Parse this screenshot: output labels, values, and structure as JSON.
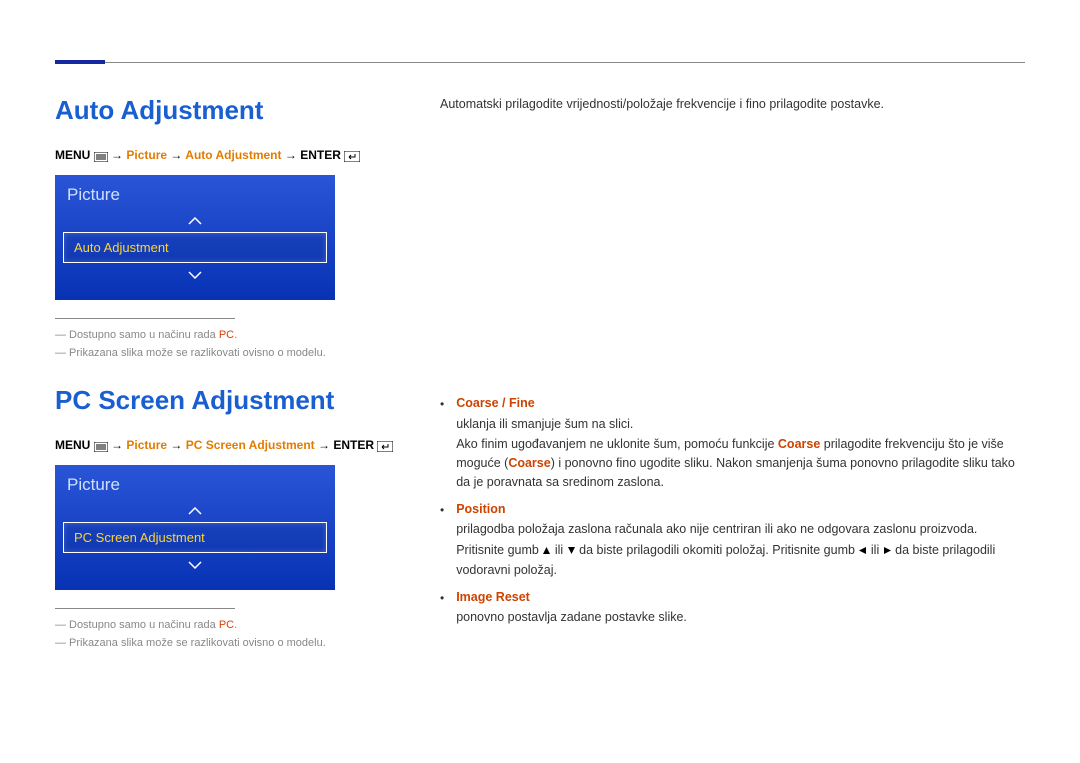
{
  "section1": {
    "title": "Auto Adjustment",
    "breadcrumb": {
      "menu": "MENU",
      "arrow": "→",
      "p1": "Picture",
      "p2": "Auto Adjustment",
      "enter": "ENTER"
    },
    "panel": {
      "title": "Picture",
      "item": "Auto Adjustment"
    },
    "notes": {
      "n1a": "Dostupno samo u načinu rada ",
      "n1b": "PC",
      "n1c": ".",
      "n2": "Prikazana slika može se razlikovati ovisno o modelu."
    }
  },
  "section2": {
    "title": "PC Screen Adjustment",
    "breadcrumb": {
      "menu": "MENU",
      "arrow": "→",
      "p1": "Picture",
      "p2": "PC Screen Adjustment",
      "enter": "ENTER"
    },
    "panel": {
      "title": "Picture",
      "item": "PC Screen Adjustment"
    },
    "notes": {
      "n1a": "Dostupno samo u načinu rada ",
      "n1b": "PC",
      "n1c": ".",
      "n2": "Prikazana slika može se razlikovati ovisno o modelu."
    }
  },
  "right": {
    "intro": "Automatski prilagodite vrijednosti/položaje frekvencije i fino prilagodite postavke.",
    "b1": {
      "label": "Coarse / Fine",
      "t1": "uklanja ili smanjuje šum na slici.",
      "t2a": "Ako finim ugođavanjem ne uklonite šum, pomoću funkcije ",
      "t2b": "Coarse",
      "t2c": " prilagodite frekvenciju što je više moguće (",
      "t2d": "Coarse",
      "t2e": ") i ponovno fino ugodite sliku. Nakon smanjenja šuma ponovno prilagodite sliku tako da je poravnata sa sredinom zaslona."
    },
    "b2": {
      "label": "Position",
      "t1": "prilagodba položaja zaslona računala ako nije centriran ili ako ne odgovara zaslonu proizvoda.",
      "t2a": "Pritisnite gumb ",
      "t2b": " ili ",
      "t2c": " da biste prilagodili okomiti položaj. Pritisnite gumb ",
      "t2d": " ili ",
      "t2e": " da biste prilagodili vodoravni položaj."
    },
    "b3": {
      "label": "Image Reset",
      "t1": "ponovno postavlja zadane postavke slike."
    }
  }
}
